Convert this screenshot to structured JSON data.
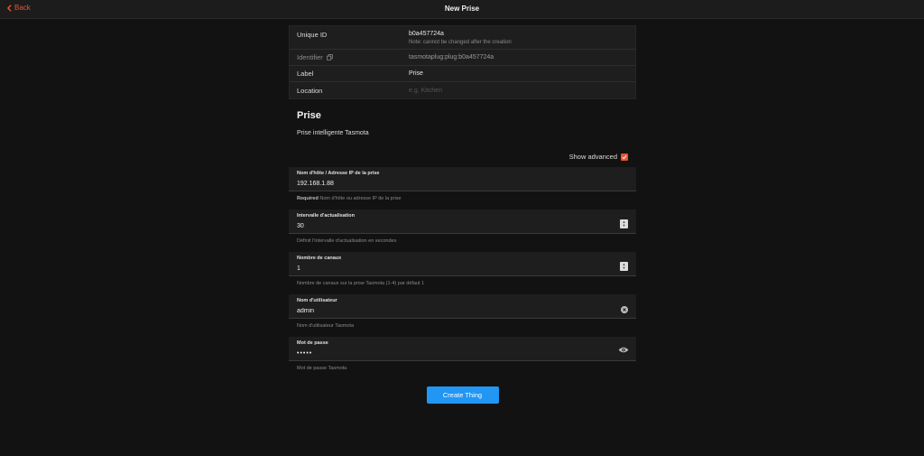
{
  "header": {
    "back_label": "Back",
    "title": "New Prise"
  },
  "info": {
    "unique_id_label": "Unique ID",
    "unique_id_value": "b0a457724a",
    "unique_id_note": "Note: cannot be changed after the creation",
    "identifier_label": "Identifier",
    "identifier_value": "tasmotaplug:plug:b0a457724a",
    "label_label": "Label",
    "label_value": "Prise",
    "location_label": "Location",
    "location_placeholder": "e.g. Kitchen"
  },
  "thing": {
    "title": "Prise",
    "description": "Prise intelligente Tasmota"
  },
  "advanced": {
    "label": "Show advanced",
    "checked": true
  },
  "fields": {
    "host": {
      "label": "Nom d'hôte / Adresse IP de la prise",
      "value": "192.168.1.88",
      "required": "Required",
      "help": "Nom d'hôte ou adresse IP de la prise"
    },
    "refresh": {
      "label": "Intervalle d'actualisation",
      "value": "30",
      "help": "Définit l'intervalle d'actualisation en secondes"
    },
    "channels": {
      "label": "Nombre de canaux",
      "value": "1",
      "help": "Nombre de canaux sur la prise Tasmota (1-4) par défaut 1"
    },
    "username": {
      "label": "Nom d'utilisateur",
      "value": "admin",
      "help": "Nom d'utilisateur Tasmota"
    },
    "password": {
      "label": "Mot de passe",
      "value": "admin",
      "help": "Mot de passe Tasmota"
    }
  },
  "actions": {
    "create_label": "Create Thing"
  },
  "colors": {
    "accent": "#e8542f",
    "primary_button": "#2196f3",
    "background": "#121212"
  }
}
